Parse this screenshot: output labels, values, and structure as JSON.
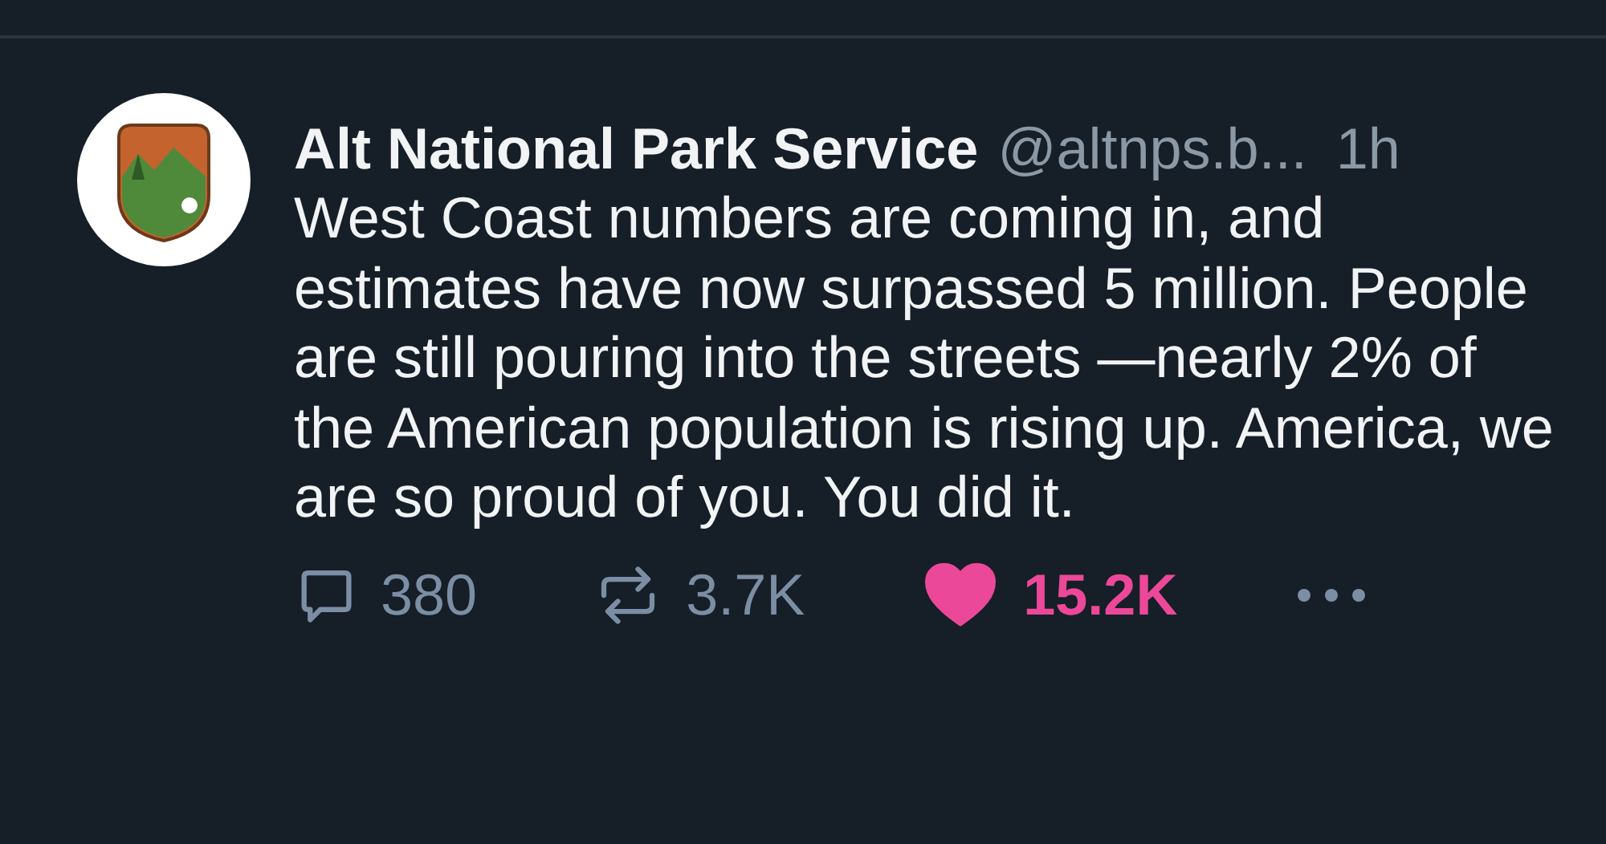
{
  "post": {
    "author": {
      "display_name": "Alt National Park Service",
      "handle": "@altnps.b...",
      "time": "1h"
    },
    "text": "West Coast numbers are coming in, and estimates have now surpassed 5 million. People are still pouring into the streets —nearly 2% of the American population is rising up. America, we are so proud of you. You did it.",
    "actions": [
      {
        "kind": "reply",
        "count": "380",
        "selected": false
      },
      {
        "kind": "repost",
        "count": "3.7K",
        "selected": false
      },
      {
        "kind": "like",
        "count": "15.2K",
        "selected": true
      },
      {
        "kind": "more"
      }
    ]
  }
}
